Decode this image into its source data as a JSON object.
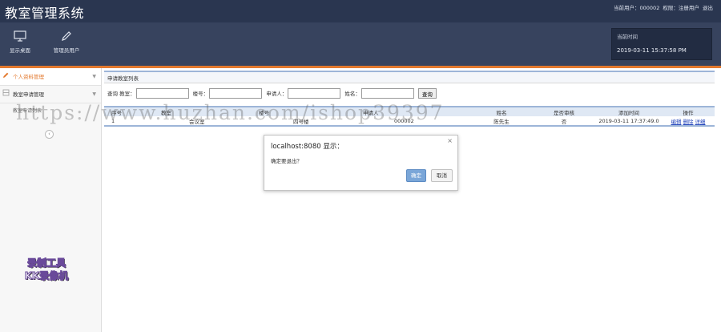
{
  "header": {
    "app_title": "教室管理系统",
    "user_label": "当前用户：000002",
    "role_label": "权限：注册用户",
    "logout": "退出"
  },
  "toolbar": {
    "show_desktop": "显示桌面",
    "manage_user": "管理员用户",
    "time_label": "当前时间",
    "time_value": "2019-03-11 15:37:58 PM"
  },
  "sidebar": {
    "items": [
      {
        "label": "个人资料管理"
      },
      {
        "label": "教室申请管理"
      }
    ],
    "sub_item": "教室申请列表",
    "collapse_icon": "‹"
  },
  "main": {
    "panel_title": "申请教室列表",
    "search": {
      "label_query_classroom": "查询 教室：",
      "label_building": "楼号：",
      "label_applicant": "申请人：",
      "label_name": "姓名：",
      "button": "查询"
    },
    "table": {
      "headers": [
        "序号",
        "教室",
        "楼号",
        "申请人",
        "姓名",
        "是否审核",
        "添加时间",
        "操作"
      ],
      "rows": [
        {
          "index": "1",
          "classroom": "会议室",
          "building": "四号楼",
          "applicant": "000002",
          "name": "陈先生",
          "reviewed": "否",
          "added_time": "2019-03-11 17:37:49.0",
          "op_edit": "编辑",
          "op_delete": "删除",
          "op_detail": "详细"
        }
      ]
    }
  },
  "dialog": {
    "title": "localhost:8080 显示：",
    "message": "确定要退出？",
    "ok": "确定",
    "cancel": "取消",
    "close_icon": "×"
  },
  "overlay": {
    "watermark": "https://www.huzhan.com/ishop39397",
    "recorder_line1": "录制工具",
    "recorder_line2": "KK录像机"
  },
  "colors": {
    "header_bg": "#2a3650",
    "toolbar_bg": "#37435e",
    "accent_orange": "#e3792e",
    "table_border_blue": "#9db5d8",
    "link_blue": "#2244bb"
  }
}
